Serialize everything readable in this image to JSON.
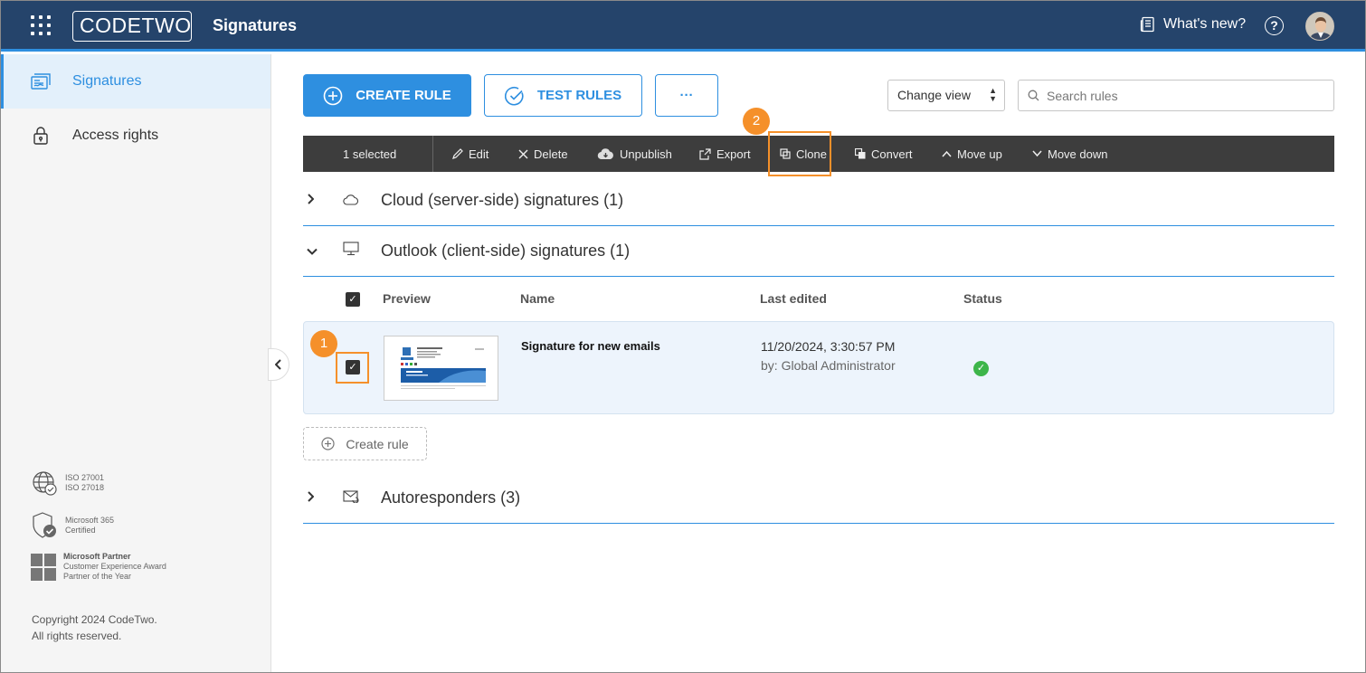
{
  "header": {
    "logo_text": "CODETWO",
    "app_title": "Signatures",
    "whats_new": "What's new?",
    "help_symbol": "?"
  },
  "sidebar": {
    "items": [
      {
        "label": "Signatures",
        "icon": "signatures-icon",
        "active": true
      },
      {
        "label": "Access rights",
        "icon": "lock-icon",
        "active": false
      }
    ],
    "badges": [
      {
        "icon": "globe-check-icon",
        "lines": [
          "ISO 27001",
          "ISO 27018"
        ]
      },
      {
        "icon": "shield-check-icon",
        "lines": [
          "Microsoft 365",
          "Certified"
        ]
      },
      {
        "icon": "microsoft-logo-icon",
        "lines": [
          "Microsoft Partner",
          "Customer Experience Award",
          "Partner of the Year"
        ]
      }
    ],
    "copyright_line1": "Copyright 2024 CodeTwo.",
    "copyright_line2": "All rights reserved."
  },
  "toolbar": {
    "create_rule": "CREATE RULE",
    "test_rules": "TEST RULES",
    "more": "···",
    "change_view": "Change view",
    "search_placeholder": "Search rules"
  },
  "actionbar": {
    "selected": "1 selected",
    "edit": "Edit",
    "delete": "Delete",
    "unpublish": "Unpublish",
    "export": "Export",
    "clone": "Clone",
    "convert": "Convert",
    "move_up": "Move up",
    "move_down": "Move down"
  },
  "callouts": {
    "one": "1",
    "two": "2"
  },
  "groups": {
    "cloud": "Cloud (server-side) signatures (1)",
    "outlook": "Outlook (client-side) signatures (1)",
    "autoresponders": "Autoresponders (3)"
  },
  "table": {
    "headers": {
      "preview": "Preview",
      "name": "Name",
      "last_edited": "Last edited",
      "status": "Status"
    },
    "rows": [
      {
        "name": "Signature for new emails",
        "date": "11/20/2024, 3:30:57 PM",
        "by": "by: Global Administrator",
        "status": "ok"
      }
    ]
  },
  "create_rule_link": "Create rule",
  "colors": {
    "brand_blue": "#2e8fe0",
    "topbar": "#25446b",
    "highlight": "#f5902a",
    "status_ok": "#3db54a"
  }
}
